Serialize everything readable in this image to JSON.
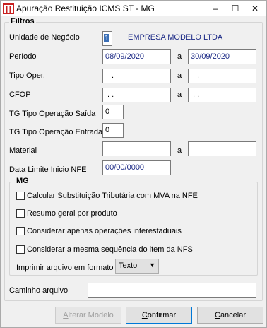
{
  "window": {
    "title": "Apuração Restituição ICMS ST - MG",
    "minimize": "–",
    "maximize": "☐",
    "close": "✕"
  },
  "filtros": {
    "legend": "Filtros",
    "unidade_label": "Unidade de Negócio",
    "unidade_code_sel": "1",
    "unidade_name": "EMPRESA MODELO LTDA",
    "periodo_label": "Período",
    "periodo_from": "08/09/2020",
    "periodo_a": "a",
    "periodo_to": "30/09/2020",
    "tipo_oper_label": "Tipo Oper.",
    "tipo_oper_from": ".",
    "tipo_oper_a": "a",
    "tipo_oper_to": ".",
    "cfop_label": "CFOP",
    "cfop_from": ". .",
    "cfop_a": "a",
    "cfop_to": ". .",
    "tg_saida_label": "TG Tipo Operação Saída",
    "tg_saida_value": "0",
    "tg_entrada_label": "TG Tipo Operação Entrada",
    "tg_entrada_value": "0",
    "material_label": "Material",
    "material_from": "",
    "material_a": "a",
    "material_to": "",
    "data_limite_label": "Data Limite Inicio NFE",
    "data_limite_value": "00/00/0000"
  },
  "mg": {
    "legend": "MG",
    "chk1": "Calcular Substituição Tributária com MVA na NFE",
    "chk2": "Resumo geral por produto",
    "chk3": "Considerar apenas operações interestaduais",
    "chk4": "Considerar a mesma sequência do item da NFS",
    "formato_label": "Imprimir arquivo em formato",
    "formato_value": "Texto"
  },
  "caminho": {
    "label": "Caminho arquivo",
    "value": ""
  },
  "buttons": {
    "alterar_u": "A",
    "alterar_rest": "lterar Modelo",
    "confirmar_u": "C",
    "confirmar_rest": "onfirmar",
    "cancelar_u": "C",
    "cancelar_rest": "ancelar"
  }
}
